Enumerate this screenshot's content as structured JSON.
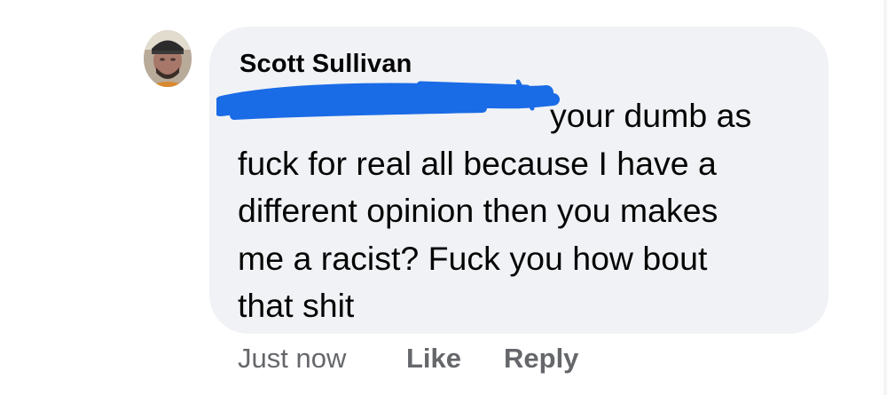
{
  "comment": {
    "author": "Scott Sullivan",
    "lines": [
      "your dumb as",
      "fuck for real all because I have a",
      "different opinion then you makes",
      "me a racist?   Fuck you how bout",
      "that shit"
    ]
  },
  "actions": {
    "timestamp": "Just now",
    "like_label": "Like",
    "reply_label": "Reply"
  },
  "colors": {
    "bubble": "#f0f2f5",
    "text": "#050505",
    "meta": "#65676b",
    "redaction": "#1a6be6"
  }
}
